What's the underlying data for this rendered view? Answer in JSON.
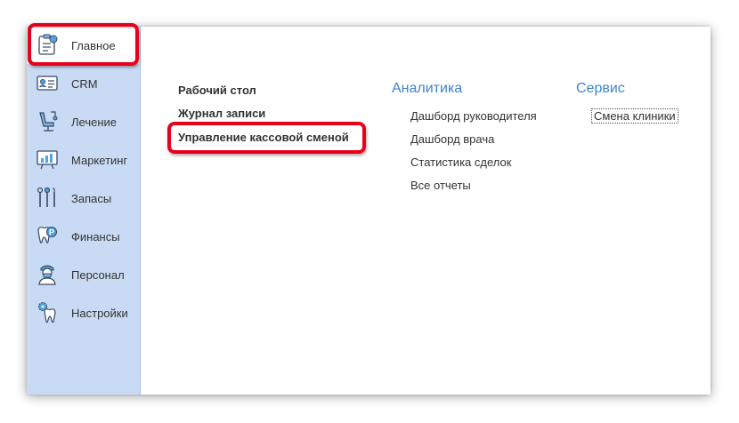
{
  "sidebar": {
    "items": [
      {
        "label": "Главное",
        "icon": "home-clipboard-icon"
      },
      {
        "label": "CRM",
        "icon": "crm-card-icon"
      },
      {
        "label": "Лечение",
        "icon": "dental-chair-icon"
      },
      {
        "label": "Маркетинг",
        "icon": "marketing-board-icon"
      },
      {
        "label": "Запасы",
        "icon": "dental-tools-icon"
      },
      {
        "label": "Финансы",
        "icon": "tooth-coin-icon"
      },
      {
        "label": "Персонал",
        "icon": "doctor-icon"
      },
      {
        "label": "Настройки",
        "icon": "tooth-gear-icon"
      }
    ]
  },
  "main": {
    "links": [
      "Рабочий стол",
      "Журнал записи",
      "Управление кассовой сменой"
    ],
    "analytics": {
      "title": "Аналитика",
      "items": [
        "Дашборд руководителя",
        "Дашборд врача",
        "Статистика сделок",
        "Все отчеты"
      ]
    },
    "service": {
      "title": "Сервис",
      "items": [
        "Смена клиники"
      ]
    }
  },
  "colors": {
    "sidebar_bg": "#c9dbf4",
    "accent": "#3d84cf",
    "highlight": "#e8001a"
  }
}
